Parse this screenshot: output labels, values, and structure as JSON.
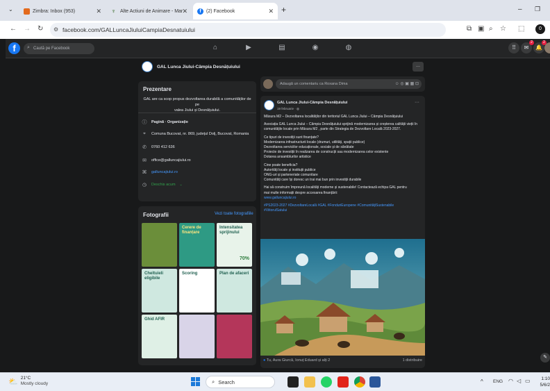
{
  "browser": {
    "tabs": [
      {
        "label": "Zimbra: Inbox (953)",
        "active": false
      },
      {
        "label": "Alte Actiuni de Animare - Mar",
        "active": false
      },
      {
        "label": "(2) Facebook",
        "active": true
      }
    ],
    "new_tab": "+",
    "url": "facebook.com/GALLuncaJiuluiCampiaDesnatuiului",
    "window_controls": {
      "minimize": "–",
      "restore": "❐"
    }
  },
  "fb": {
    "search_placeholder": "Caută pe Facebook",
    "notif_badge": "2",
    "messenger_badge": "2"
  },
  "page": {
    "name": "GAL Lunca Jiului-Câmpia Desnățuiului",
    "more": "···"
  },
  "intro": {
    "title": "Prezentare",
    "description_lines": [
      "GAL are ca scop propus dezvoltarea durabilă a comunităților de pe",
      "valea Jiului și Desnățuiului."
    ],
    "category": "Pagină · Organizație",
    "address": "Comuna Bucovat, nr. 869, județul Dolj, Bucovat, Romania",
    "phone": "0760 412 636",
    "email": "office@galluncajiului.ro",
    "website": "galluncajiului.ro",
    "hours": "Deschis acum"
  },
  "photos": {
    "title": "Fotografii",
    "see_all": "Vezi toate fotografiile",
    "tiles": [
      {
        "title": "",
        "bg": "#6b8e3a"
      },
      {
        "title": "Cerere de finanțare",
        "bg": "#2e9a84"
      },
      {
        "title": "Intensitatea sprijinului",
        "bg": "#e8f3ea",
        "extra": "70%"
      },
      {
        "title": "Cheltuieli eligibile",
        "bg": "#cfe8e0"
      },
      {
        "title": "Scoring",
        "bg": "#ffffff"
      },
      {
        "title": "Plan de afaceri",
        "bg": "#cfe8e0"
      },
      {
        "title": "Ghid AFIR",
        "bg": "#dff0e6"
      },
      {
        "title": "",
        "bg": "#d9d4e8"
      },
      {
        "title": "",
        "bg": "#b4365a"
      }
    ]
  },
  "composer": {
    "placeholder": "Adaugă un comentariu ca Roxana Dima"
  },
  "post": {
    "author": "GAL Lunca Jiului-Câmpia Desnățuiului",
    "date": "19 februarie",
    "lines": [
      "Măsura M2 – Dezvoltarea localităților din teritoriul GAL Lunca Jiului – Câmpia Desnățuiului",
      "",
      "Asociația GAL Lunca Jiului – Câmpia Desnățuiului sprijină modernizarea și creșterea calității vieții în",
      "comunitățile locale prin Măsura M2 , parte din Strategia de Dezvoltare Locală 2023-2027.",
      "",
      "Ce tipuri de investiții sunt finanțate?",
      "Modernizarea infrastructurii locale (drumuri, utilități, spații publice)",
      "Dezvoltarea serviciilor educaționale, sociale și de sănătate",
      "Proiecte de investiții în realizarea de construcții sau modernizarea celor existente",
      "Dotarea ansamblurilor artistice",
      "",
      "Cine poate beneficia?",
      "Autorități locale și instituții publice",
      "ONG-uri și parteneriate comunitare",
      "Comunități care își doresc un trai mai bun prin investiții durabile",
      "",
      "Hai să construim împreună localități moderne și sustenabile! Contactează echipa GAL pentru",
      "mai multe informații despre accesarea finanțării:"
    ],
    "link": "www.galluncajiului.ro",
    "hashtags_1": "#PS2023-2027 #DezvoltareLocală #GAL #FonduriEuropene #ComunitățiSustenabile",
    "hashtags_2": "#ViitorulSatului",
    "reactions": "Tu, Aura Giurcă, Ionuț Eduard și alți 2",
    "shares": "1 distribuire"
  },
  "taskbar": {
    "weather_temp": "21°C",
    "weather_desc": "Mostly cloudy",
    "search": "Search",
    "lang": "ENG",
    "time": "1:10",
    "date": "5/6/2"
  }
}
